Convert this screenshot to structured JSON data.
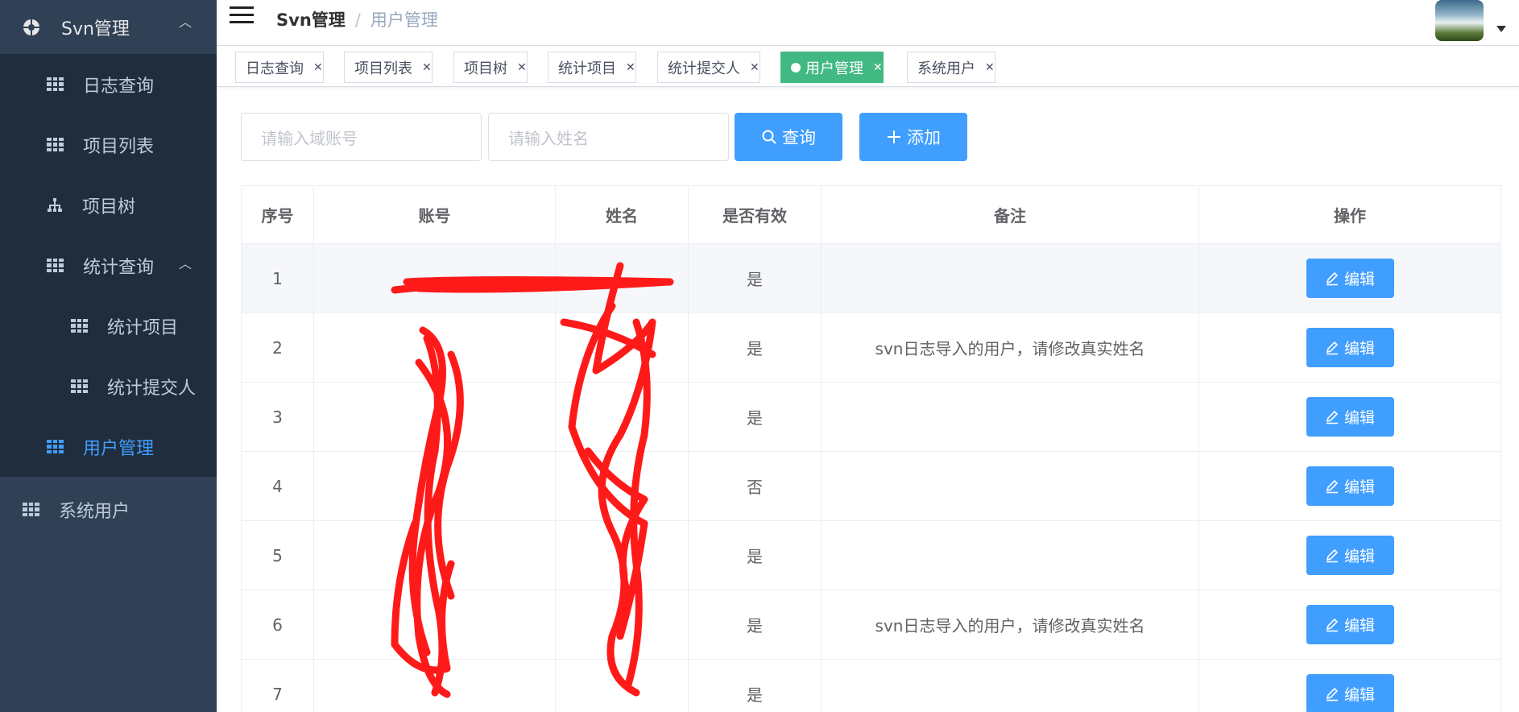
{
  "sidebar": {
    "top": {
      "label": "Svn管理",
      "icon": "logo-icon"
    },
    "items": [
      {
        "label": "日志查询",
        "icon": "table-icon"
      },
      {
        "label": "项目列表",
        "icon": "table-icon"
      },
      {
        "label": "项目树",
        "icon": "tree-icon"
      },
      {
        "label": "统计查询",
        "icon": "table-icon"
      },
      {
        "label": "统计项目",
        "icon": "table-icon"
      },
      {
        "label": "统计提交人",
        "icon": "table-icon"
      },
      {
        "label": "用户管理",
        "icon": "table-icon"
      },
      {
        "label": "系统用户",
        "icon": "table-icon"
      }
    ],
    "active_color": "#409eff",
    "bg_color": "#304156"
  },
  "header": {
    "breadcrumb": [
      "Svn管理",
      "用户管理"
    ],
    "separator": "/"
  },
  "tags": [
    {
      "label": "日志查询"
    },
    {
      "label": "项目列表"
    },
    {
      "label": "项目树"
    },
    {
      "label": "统计项目"
    },
    {
      "label": "统计提交人"
    },
    {
      "label": "用户管理",
      "active": true
    },
    {
      "label": "系统用户"
    }
  ],
  "filter": {
    "account_placeholder": "请输入域账号",
    "name_placeholder": "请输入姓名",
    "search_label": "查询",
    "add_label": "添加"
  },
  "table": {
    "columns": [
      "序号",
      "账号",
      "姓名",
      "是否有效",
      "备注",
      "操作"
    ],
    "rows": [
      {
        "idx": "1",
        "account": "",
        "name": "",
        "valid": "是",
        "note": "",
        "action": "编辑"
      },
      {
        "idx": "2",
        "account": "",
        "name": "",
        "valid": "是",
        "note": "svn日志导入的用户，请修改真实姓名",
        "action": "编辑"
      },
      {
        "idx": "3",
        "account": "",
        "name": "",
        "valid": "是",
        "note": "",
        "action": "编辑"
      },
      {
        "idx": "4",
        "account": "",
        "name": "",
        "valid": "否",
        "note": "",
        "action": "编辑"
      },
      {
        "idx": "5",
        "account": "",
        "name": "",
        "valid": "是",
        "note": "",
        "action": "编辑"
      },
      {
        "idx": "6",
        "account": "",
        "name": "",
        "valid": "是",
        "note": "svn日志导入的用户，请修改真实姓名",
        "action": "编辑"
      },
      {
        "idx": "7",
        "account": "",
        "name": "",
        "valid": "是",
        "note": "",
        "action": "编辑"
      }
    ]
  },
  "colors": {
    "primary": "#409eff",
    "active_tag": "#42b983",
    "redaction": "#ff1a1a"
  }
}
